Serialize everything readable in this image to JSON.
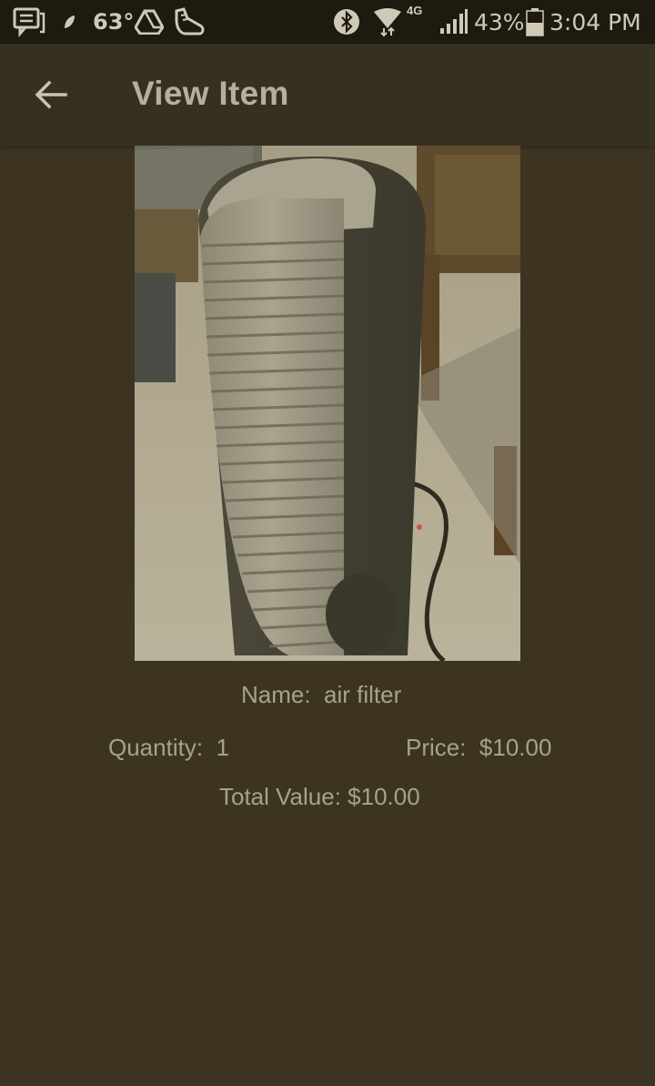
{
  "status_bar": {
    "temperature": "63°",
    "network": "4G",
    "battery_percent": "43%",
    "time": "3:04 PM",
    "icons": [
      "messages-icon",
      "leaf-icon",
      "drive-icon",
      "shoe-icon",
      "bluetooth-icon",
      "wifi-icon",
      "signal-icon",
      "battery-icon"
    ]
  },
  "app_bar": {
    "title": "View Item",
    "back_icon": "arrow-left-icon"
  },
  "item": {
    "photo_alt": "air filter photo",
    "name_label": "Name:",
    "name_value": "air filter",
    "quantity_label": "Quantity:",
    "quantity_value": "1",
    "price_label": "Price:",
    "price_value": "$10.00",
    "total_label": "Total Value:",
    "total_value": "$10.00"
  },
  "colors": {
    "background": "#3c3421",
    "status_bar": "#1e1a0f",
    "app_bar": "#353020",
    "text": "#a7a18c"
  }
}
